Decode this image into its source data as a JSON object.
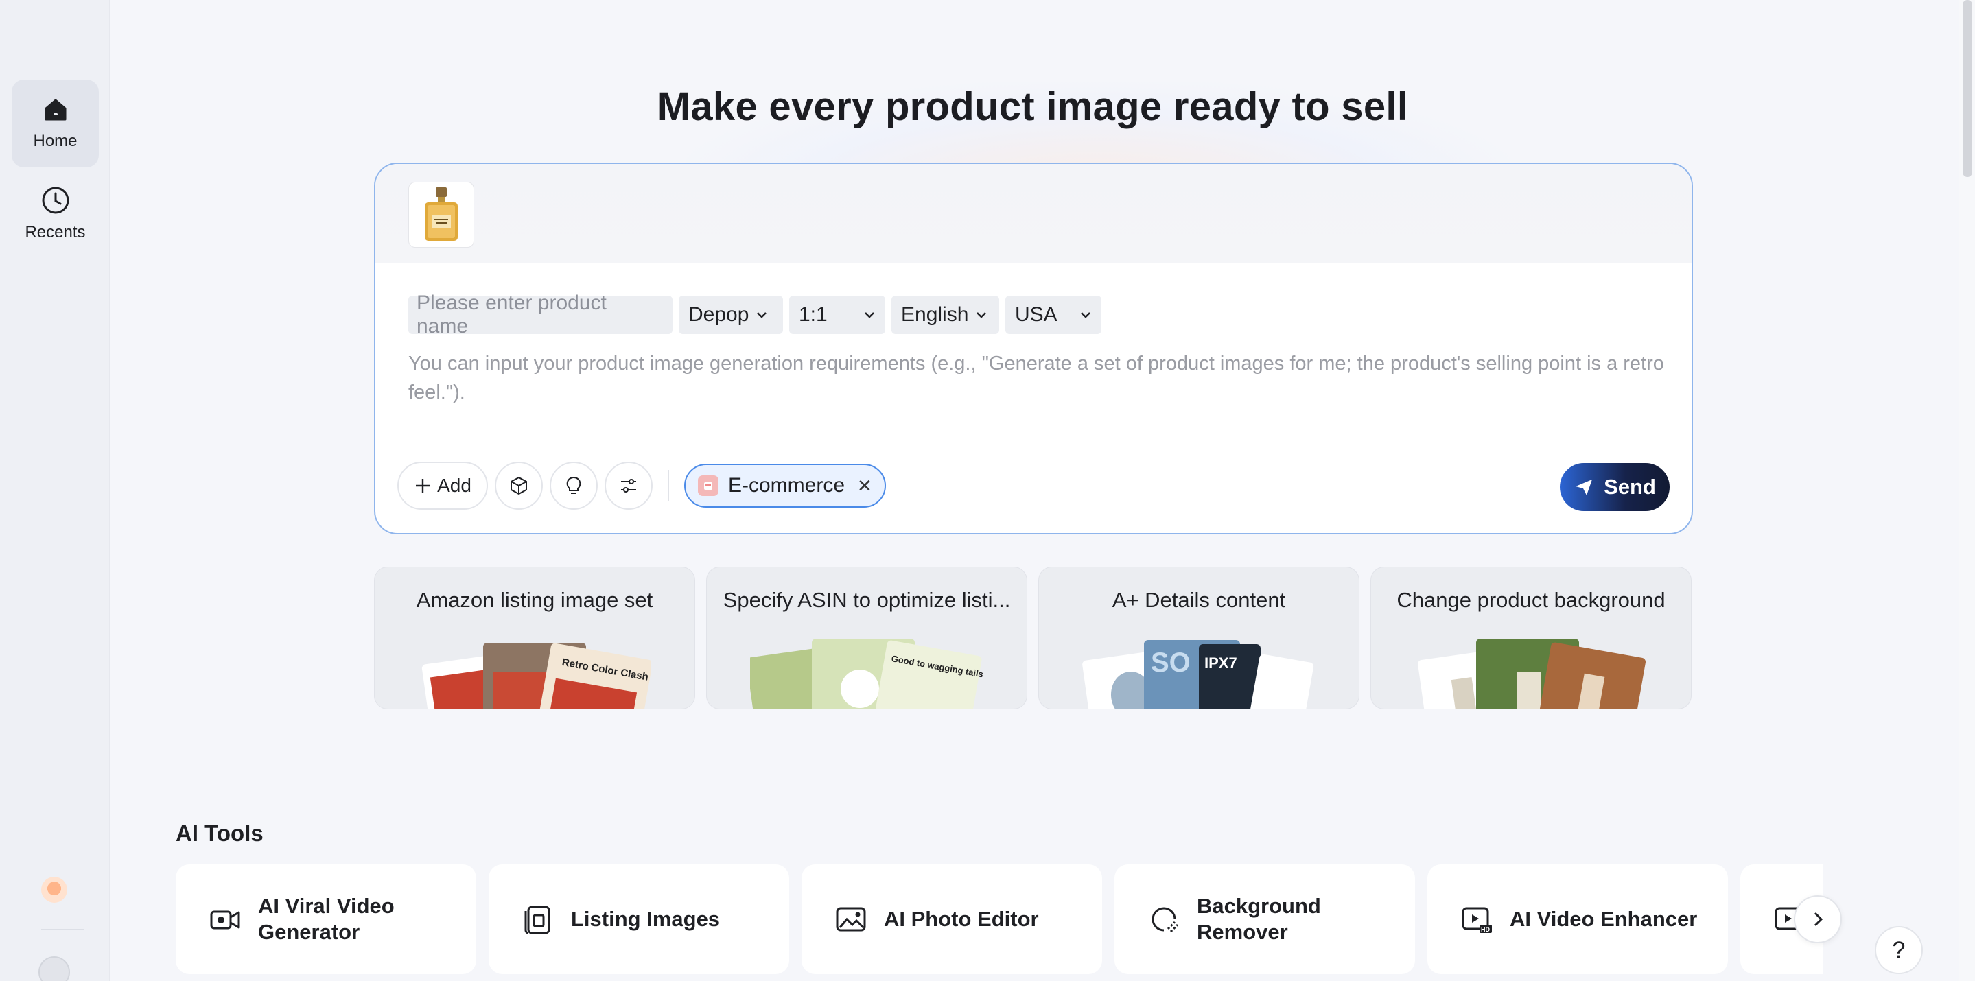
{
  "sidebar": {
    "items": [
      {
        "label": "Home",
        "icon": "home-icon",
        "active": true
      },
      {
        "label": "Recents",
        "icon": "clock-icon",
        "active": false
      }
    ]
  },
  "main": {
    "title": "Make every product image ready to sell",
    "composer": {
      "product_placeholder": "Please enter product name",
      "platform": "Depop",
      "ratio": "1:1",
      "language": "English",
      "region": "USA",
      "prompt_placeholder": "You can input your product image generation requirements (e.g., \"Generate a set of product images for me; the product's selling point is a retro feel.\").",
      "add_label": "Add",
      "chip_label": "E-commerce",
      "send_label": "Send"
    },
    "cards": [
      {
        "title": "Amazon listing image set",
        "art_text": "Retro Color Clash"
      },
      {
        "title": "Specify ASIN to optimize listi...",
        "art_text": "Good to wagging tails"
      },
      {
        "title": "A+ Details content",
        "art_text": "IPX7"
      },
      {
        "title": "Change product background",
        "art_text": ""
      }
    ],
    "tools_heading": "AI Tools",
    "tools": [
      {
        "label": "AI Viral Video Generator",
        "icon": "video-camera-icon"
      },
      {
        "label": "Listing Images",
        "icon": "listing-icon"
      },
      {
        "label": "AI Photo Editor",
        "icon": "photo-icon"
      },
      {
        "label": "Background Remover",
        "icon": "eraser-icon"
      },
      {
        "label": "AI Video Enhancer",
        "icon": "hd-video-icon"
      }
    ],
    "help_label": "?"
  },
  "colors": {
    "accent": "#4a8ae8",
    "send_bg": "#16224a",
    "composer_border": "#8fb5ec"
  }
}
